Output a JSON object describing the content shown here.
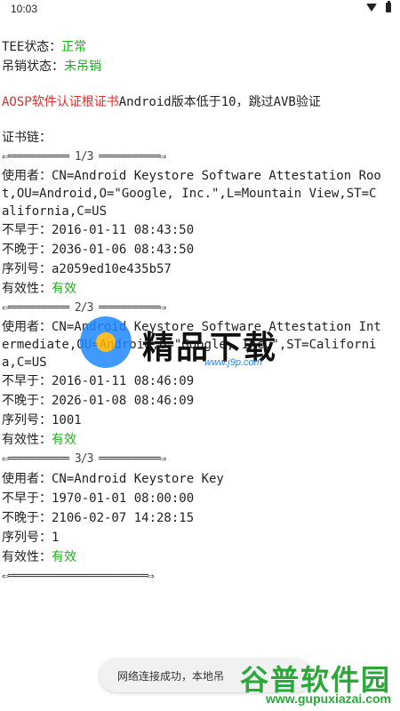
{
  "status_bar": {
    "time": "10:03",
    "wifi_icon": "wifi-icon",
    "battery_icon": "battery-icon"
  },
  "tee": {
    "label": "TEE状态：",
    "value": "正常"
  },
  "revoke": {
    "label": "吊销状态：",
    "value": "未吊销"
  },
  "aosp_notice": {
    "prefix": "AOSP软件认证根证书",
    "text": "Android版本低于10，跳过AVB验证"
  },
  "chain_label": "证书链：",
  "certs": [
    {
      "sep": "⇐══════════ 1/3 ══════════⇒",
      "subject_label": "使用者：",
      "subject": "CN=Android Keystore Software Attestation Root,OU=Android,O=\"Google, Inc.\",L=Mountain View,ST=California,C=US",
      "not_before_label": "不早于：",
      "not_before": "2016-01-11 08:43:50",
      "not_after_label": "不晚于：",
      "not_after": "2036-01-06 08:43:50",
      "serial_label": "序列号：",
      "serial": "a2059ed10e435b57",
      "validity_label": "有效性：",
      "validity": "有效"
    },
    {
      "sep": "⇐══════════ 2/3 ══════════⇒",
      "subject_label": "使用者：",
      "subject": "CN=Android Keystore Software Attestation Intermediate,OU=Android,O=\"Google, Inc.\",ST=California,C=US",
      "not_before_label": "不早于：",
      "not_before": "2016-01-11 08:46:09",
      "not_after_label": "不晚于：",
      "not_after": "2026-01-08 08:46:09",
      "serial_label": "序列号：",
      "serial": "1001",
      "validity_label": "有效性：",
      "validity": "有效"
    },
    {
      "sep": "⇐══════════ 3/3 ══════════⇒",
      "subject_label": "使用者：",
      "subject": "CN=Android Keystore Key",
      "not_before_label": "不早于：",
      "not_before": "1970-01-01 08:00:00",
      "not_after_label": "不晚于：",
      "not_after": "2106-02-07 14:28:15",
      "serial_label": "序列号：",
      "serial": "1",
      "validity_label": "有效性：",
      "validity": "有效"
    }
  ],
  "end_sep": "⇐═══════════════════════⇒",
  "toast": "网络连接成功，本地吊",
  "watermark": {
    "title": "精品下载",
    "url": "www.j9p.com"
  },
  "brand": {
    "cn": "谷普软件园",
    "en": "www.gupuxiazai.com"
  },
  "colors": {
    "ok": "#1db31d",
    "red": "#e03030"
  }
}
